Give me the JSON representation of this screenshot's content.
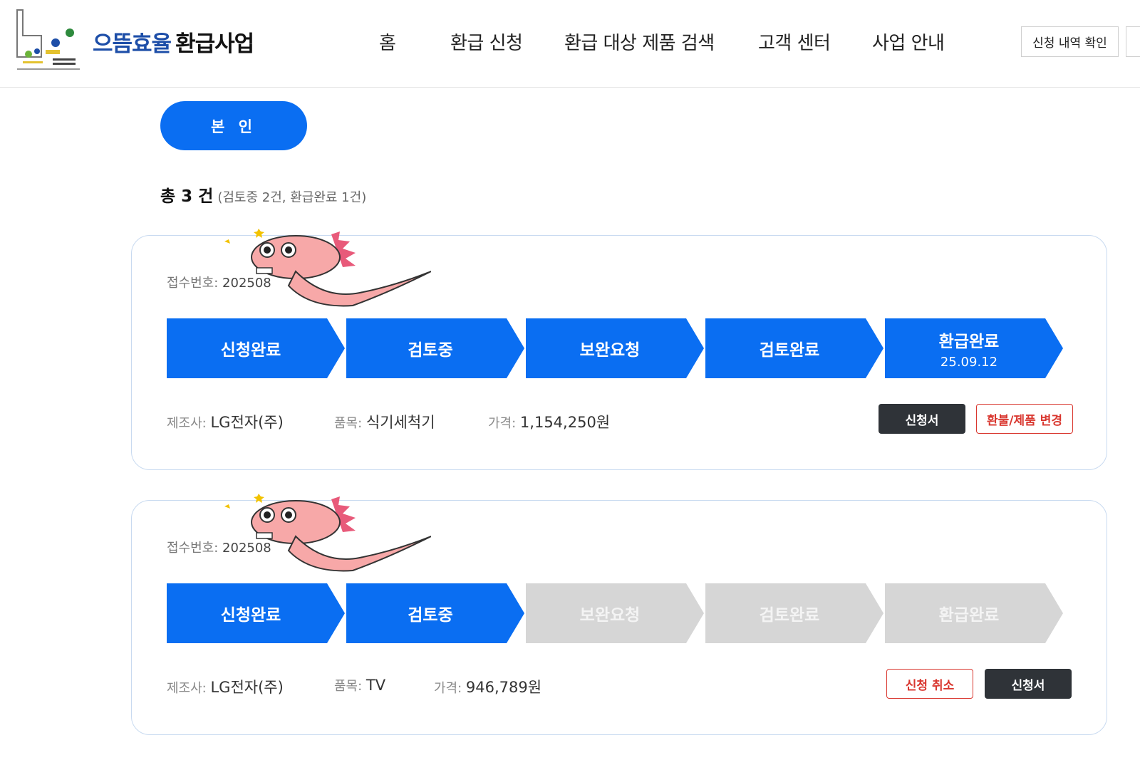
{
  "header": {
    "brand_part1": "으뜸효율",
    "brand_part2": "환급사업",
    "nav": [
      "홈",
      "환급 신청",
      "환급 대상 제품 검색",
      "고객 센터",
      "사업 안내"
    ],
    "check_button": "신청 내역 확인"
  },
  "applicant": {
    "label": "본 인"
  },
  "summary": {
    "total": "총 3 건",
    "detail": "(검토중 2건, 환급완료 1건)"
  },
  "cards": [
    {
      "receipt_label": "접수번호:",
      "receipt_value": "202508",
      "steps": [
        {
          "label": "신청완료",
          "date": "",
          "active": true
        },
        {
          "label": "검토중",
          "date": "",
          "active": true
        },
        {
          "label": "보완요청",
          "date": "",
          "active": true
        },
        {
          "label": "검토완료",
          "date": "",
          "active": true
        },
        {
          "label": "환급완료",
          "date": "25.09.12",
          "active": true
        }
      ],
      "maker_label": "제조사:",
      "maker": "LG전자(주)",
      "item_label": "품목:",
      "item": "식기세척기",
      "price_label": "가격:",
      "price": "1,154,250원",
      "buttons": {
        "form": "신청서",
        "refund_change": "환불/제품 변경"
      }
    },
    {
      "receipt_label": "접수번호:",
      "receipt_value": "202508",
      "steps": [
        {
          "label": "신청완료",
          "date": "",
          "active": true
        },
        {
          "label": "검토중",
          "date": "",
          "active": true
        },
        {
          "label": "보완요청",
          "date": "",
          "active": false
        },
        {
          "label": "검토완료",
          "date": "",
          "active": false
        },
        {
          "label": "환급완료",
          "date": "",
          "active": false
        }
      ],
      "maker_label": "제조사:",
      "maker": "LG전자(주)",
      "item_label": "품목:",
      "item": "TV",
      "price_label": "가격:",
      "price": "946,789원",
      "buttons": {
        "cancel": "신청 취소",
        "form": "신청서"
      }
    }
  ],
  "colors": {
    "primary": "#0a6ef2",
    "brand_blue": "#1d4ea8",
    "inactive_step": "#d6d6d6",
    "danger": "#d9372f",
    "dark_button": "#2f3338",
    "mascot": "#f7a8a8"
  },
  "icons": [
    "logo-mark",
    "dinosaur-mascot"
  ]
}
